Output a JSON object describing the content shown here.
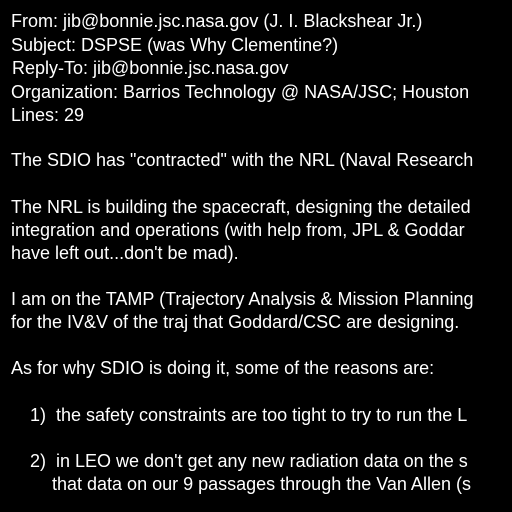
{
  "colors": {
    "background": "#000000",
    "text": "#ffffff"
  },
  "header": {
    "from": "From: jib@bonnie.jsc.nasa.gov (J. I. Blackshear Jr.)",
    "subject": "Subject: DSPSE (was Why Clementine?)",
    "reply_to": "Reply-To: jib@bonnie.jsc.nasa.gov",
    "organization": "Organization: Barrios Technology @ NASA/JSC; Houston",
    "lines": "Lines: 29"
  },
  "body": {
    "p1": "The SDIO has \"contracted\" with the NRL (Naval Research",
    "p2_line1": "The NRL is building the spacecraft, designing the detailed",
    "p2_line2": "integration and operations (with help from, JPL & Goddar",
    "p2_line3": "have left out...don't be mad).",
    "p3_line1": "I am on the TAMP (Trajectory Analysis & Mission Planning",
    "p3_line2": "for the IV&V of the traj that Goddard/CSC are designing.",
    "p4": "As for why SDIO is doing it, some of the reasons are:",
    "reason1": "1)  the safety constraints are too tight to try to run the L",
    "reason2_line1": "2)  in LEO we don't get any new radiation data on the s",
    "reason2_line2": "that data on our 9 passages through the Van Allen (s"
  }
}
